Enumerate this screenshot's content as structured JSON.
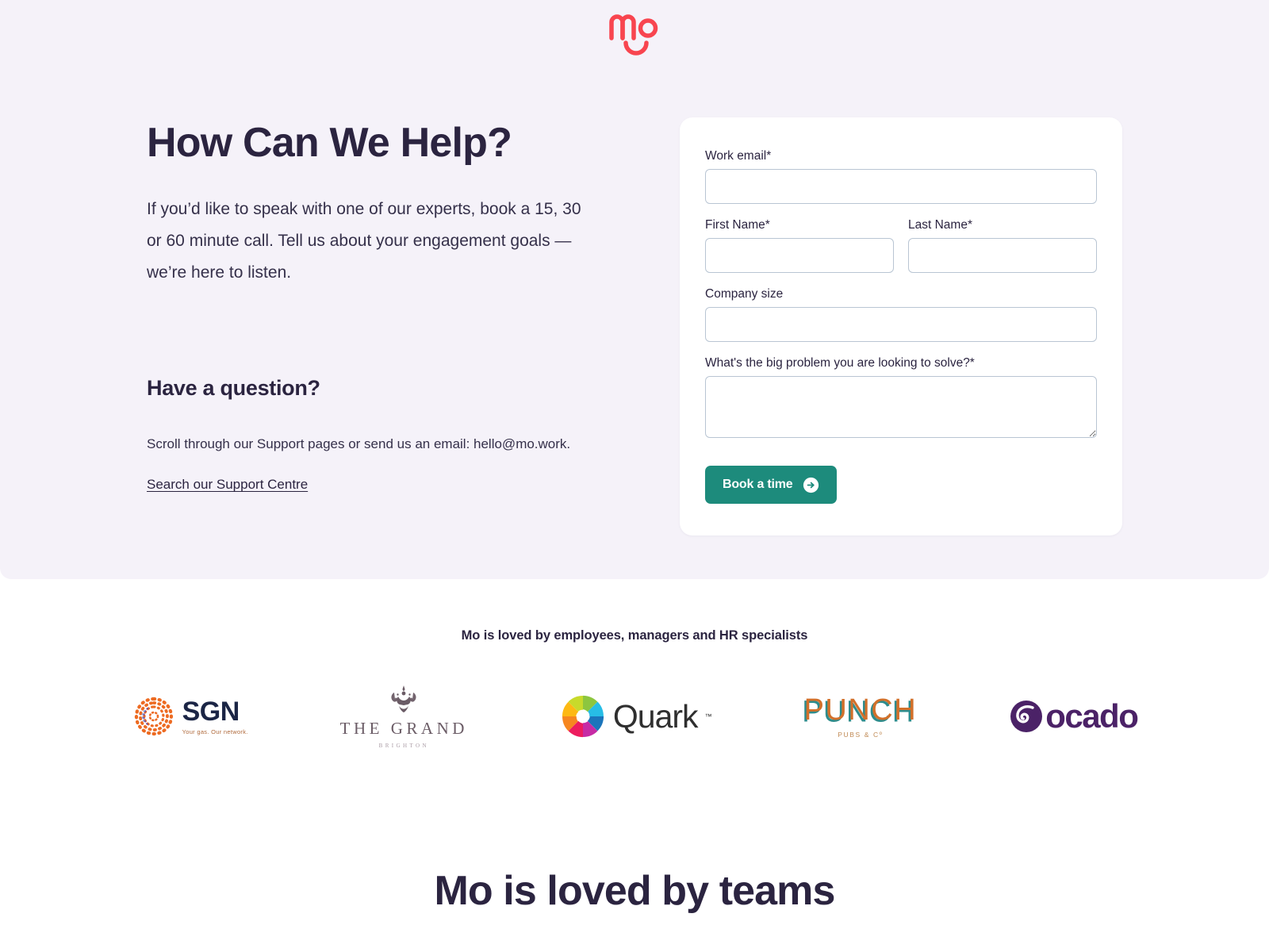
{
  "brand": {
    "logo_name": "mo-logo",
    "logo_color": "#F8454F"
  },
  "hero": {
    "title": "How Can We Help?",
    "lede": "If you’d like to speak with one of our experts, book a 15, 30 or 60 minute call. Tell us about your engagement goals — we’re here to listen.",
    "question_title": "Have a question?",
    "question_text": "Scroll through our Support pages or send us an email: hello@mo.work.",
    "support_link": "Search our Support Centre",
    "background_color": "#F5F2F9"
  },
  "form": {
    "fields": [
      {
        "name": "work-email",
        "label": "Work email*",
        "value": "",
        "placeholder": ""
      },
      {
        "name": "first-name",
        "label": "First Name*",
        "value": "",
        "placeholder": ""
      },
      {
        "name": "last-name",
        "label": "Last Name*",
        "value": "",
        "placeholder": ""
      },
      {
        "name": "company-size",
        "label": "Company size",
        "value": "",
        "placeholder": ""
      },
      {
        "name": "big-problem",
        "label": "What's the big problem you are looking to solve?*",
        "value": "",
        "placeholder": ""
      }
    ],
    "submit_label": "Book a time",
    "submit_icon": "arrow-right-circle-icon",
    "submit_color": "#1D8B7C"
  },
  "logos": {
    "heading": "Mo is loved by employees, managers and HR specialists",
    "items": [
      {
        "name": "sgn",
        "label": "SGN",
        "tagline": "Your gas. Our network."
      },
      {
        "name": "the-grand-brighton",
        "label": "THE GRAND",
        "tagline": "BRIGHTON"
      },
      {
        "name": "quark",
        "label": "Quark",
        "tagline": ""
      },
      {
        "name": "punch",
        "label": "PUNCH",
        "tagline": "PUBS & Cº"
      },
      {
        "name": "ocado",
        "label": "ocado",
        "tagline": ""
      }
    ]
  },
  "bottom": {
    "heading": "Mo is loved by teams"
  }
}
